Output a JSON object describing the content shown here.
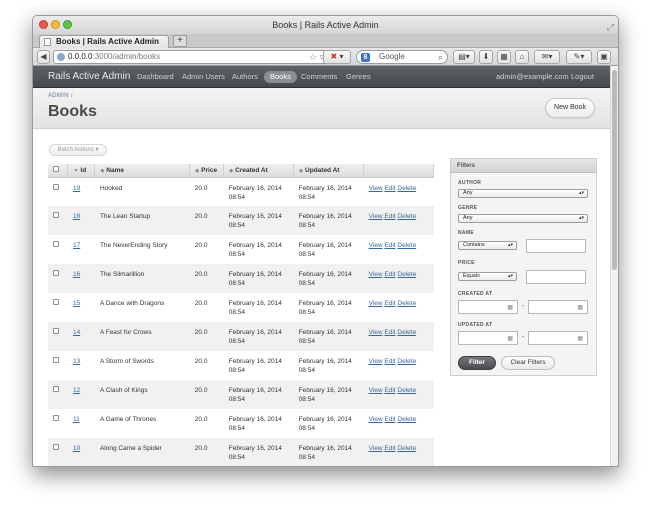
{
  "browser": {
    "window_title": "Books | Rails Active Admin",
    "tab_title": "Books | Rails Active Admin",
    "new_tab_label": "+",
    "url_host": "0.0.0.0",
    "url_path": ":3000/admin/books",
    "search_placeholder": "Google",
    "search_engine_letter": "8"
  },
  "app": {
    "site_title": "Rails Active Admin",
    "menu": [
      {
        "label": "Dashboard",
        "current": false
      },
      {
        "label": "Admin Users",
        "current": false
      },
      {
        "label": "Authors",
        "current": false
      },
      {
        "label": "Books",
        "current": true
      },
      {
        "label": "Comments",
        "current": false
      },
      {
        "label": "Genres",
        "current": false
      }
    ],
    "user_email": "admin@example.com",
    "logout_label": "Logout"
  },
  "page": {
    "breadcrumb_admin": "ADMIN",
    "breadcrumb_sep": "/",
    "title": "Books",
    "new_button": "New Book",
    "batch_actions": "Batch Actions"
  },
  "table": {
    "headers": {
      "id": "Id",
      "name": "Name",
      "price": "Price",
      "created_at": "Created At",
      "updated_at": "Updated At"
    },
    "actions": {
      "view": "View",
      "edit": "Edit",
      "delete": "Delete"
    },
    "rows": [
      {
        "id": "19",
        "name": "Hooked",
        "price": "20.0",
        "created_date": "February 16, 2014",
        "created_time": "08:54",
        "updated_date": "February 16, 2014",
        "updated_time": "08:54"
      },
      {
        "id": "18",
        "name": "The Lean Startup",
        "price": "20.0",
        "created_date": "February 16, 2014",
        "created_time": "08:54",
        "updated_date": "February 16, 2014",
        "updated_time": "08:54"
      },
      {
        "id": "17",
        "name": "The NeverEnding Story",
        "price": "20.0",
        "created_date": "February 16, 2014",
        "created_time": "08:54",
        "updated_date": "February 16, 2014",
        "updated_time": "08:54"
      },
      {
        "id": "16",
        "name": "The Silmarillion",
        "price": "20.0",
        "created_date": "February 16, 2014",
        "created_time": "08:54",
        "updated_date": "February 16, 2014",
        "updated_time": "08:54"
      },
      {
        "id": "15",
        "name": "A Dance with Dragons",
        "price": "20.0",
        "created_date": "February 16, 2014",
        "created_time": "08:54",
        "updated_date": "February 16, 2014",
        "updated_time": "08:54"
      },
      {
        "id": "14",
        "name": "A Feast for Crows",
        "price": "20.0",
        "created_date": "February 16, 2014",
        "created_time": "08:54",
        "updated_date": "February 16, 2014",
        "updated_time": "08:54"
      },
      {
        "id": "13",
        "name": "A Storm of Swords",
        "price": "20.0",
        "created_date": "February 16, 2014",
        "created_time": "08:54",
        "updated_date": "February 16, 2014",
        "updated_time": "08:54"
      },
      {
        "id": "12",
        "name": "A Clash of Kings",
        "price": "20.0",
        "created_date": "February 16, 2014",
        "created_time": "08:54",
        "updated_date": "February 16, 2014",
        "updated_time": "08:54"
      },
      {
        "id": "11",
        "name": "A Game of Thrones",
        "price": "20.0",
        "created_date": "February 16, 2014",
        "created_time": "08:54",
        "updated_date": "February 16, 2014",
        "updated_time": "08:54"
      },
      {
        "id": "10",
        "name": "Along Came a Spider",
        "price": "20.0",
        "created_date": "February 16, 2014",
        "created_time": "08:54",
        "updated_date": "February 16, 2014",
        "updated_time": "08:54"
      }
    ]
  },
  "filters": {
    "title": "Filters",
    "author_label": "AUTHOR",
    "author_value": "Any",
    "genre_label": "GENRE",
    "genre_value": "Any",
    "name_label": "NAME",
    "name_op": "Contains",
    "price_label": "PRICE",
    "price_op": "Equals",
    "created_label": "CREATED AT",
    "updated_label": "UPDATED AT",
    "range_sep": "-",
    "filter_button": "Filter",
    "clear_button": "Clear Filters"
  },
  "colors": {
    "link": "#38679c",
    "header_bar": "#45484c",
    "traffic_red": "#e85b4d",
    "traffic_yellow": "#f3bb3a",
    "traffic_green": "#5fc446"
  }
}
